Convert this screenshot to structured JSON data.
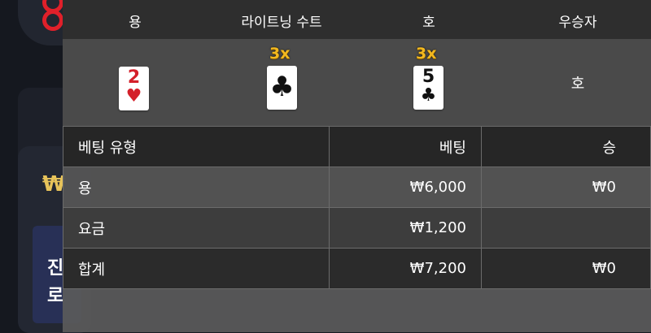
{
  "header": {
    "col_dragon": "용",
    "col_lightning_suit": "라이트닝 수트",
    "col_tiger": "호",
    "col_winner": "우승자"
  },
  "cards": {
    "dragon": {
      "rank": "2",
      "suit": "♥",
      "color": "#d4202a"
    },
    "lightning": {
      "rank": "",
      "suit": "♣",
      "multiplier": "3x",
      "color": "#111111"
    },
    "tiger": {
      "rank": "5",
      "suit": "♣",
      "multiplier": "3x",
      "color": "#111111"
    }
  },
  "winner": "호",
  "bets_table": {
    "headers": [
      "베팅 유형",
      "베팅",
      "승"
    ],
    "rows": [
      {
        "type": "용",
        "bet": "₩6,000",
        "win": "₩0"
      },
      {
        "type": "요금",
        "bet": "₩1,200",
        "win": ""
      },
      {
        "type": "합계",
        "bet": "₩7,200",
        "win": "₩0"
      }
    ]
  },
  "background": {
    "currency_symbol": "₩",
    "text_line1": "진",
    "text_line2": "로"
  },
  "colors": {
    "accent_gold": "#f2b81f",
    "logo_red": "#e0202a"
  }
}
